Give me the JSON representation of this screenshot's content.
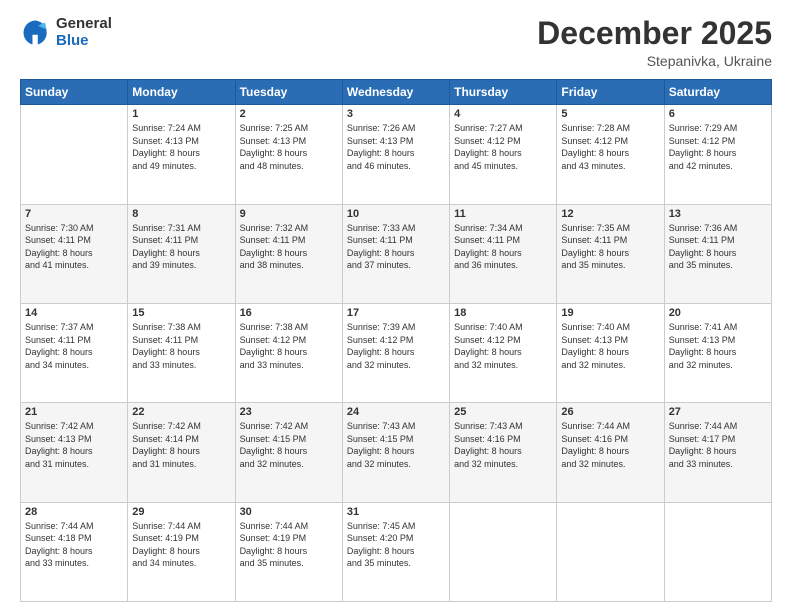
{
  "header": {
    "logo": {
      "general": "General",
      "blue": "Blue"
    },
    "title": "December 2025",
    "subtitle": "Stepanivka, Ukraine"
  },
  "calendar": {
    "days_of_week": [
      "Sunday",
      "Monday",
      "Tuesday",
      "Wednesday",
      "Thursday",
      "Friday",
      "Saturday"
    ],
    "weeks": [
      [
        {
          "day": "",
          "lines": []
        },
        {
          "day": "1",
          "lines": [
            "Sunrise: 7:24 AM",
            "Sunset: 4:13 PM",
            "Daylight: 8 hours",
            "and 49 minutes."
          ]
        },
        {
          "day": "2",
          "lines": [
            "Sunrise: 7:25 AM",
            "Sunset: 4:13 PM",
            "Daylight: 8 hours",
            "and 48 minutes."
          ]
        },
        {
          "day": "3",
          "lines": [
            "Sunrise: 7:26 AM",
            "Sunset: 4:13 PM",
            "Daylight: 8 hours",
            "and 46 minutes."
          ]
        },
        {
          "day": "4",
          "lines": [
            "Sunrise: 7:27 AM",
            "Sunset: 4:12 PM",
            "Daylight: 8 hours",
            "and 45 minutes."
          ]
        },
        {
          "day": "5",
          "lines": [
            "Sunrise: 7:28 AM",
            "Sunset: 4:12 PM",
            "Daylight: 8 hours",
            "and 43 minutes."
          ]
        },
        {
          "day": "6",
          "lines": [
            "Sunrise: 7:29 AM",
            "Sunset: 4:12 PM",
            "Daylight: 8 hours",
            "and 42 minutes."
          ]
        }
      ],
      [
        {
          "day": "7",
          "lines": [
            "Sunrise: 7:30 AM",
            "Sunset: 4:11 PM",
            "Daylight: 8 hours",
            "and 41 minutes."
          ]
        },
        {
          "day": "8",
          "lines": [
            "Sunrise: 7:31 AM",
            "Sunset: 4:11 PM",
            "Daylight: 8 hours",
            "and 39 minutes."
          ]
        },
        {
          "day": "9",
          "lines": [
            "Sunrise: 7:32 AM",
            "Sunset: 4:11 PM",
            "Daylight: 8 hours",
            "and 38 minutes."
          ]
        },
        {
          "day": "10",
          "lines": [
            "Sunrise: 7:33 AM",
            "Sunset: 4:11 PM",
            "Daylight: 8 hours",
            "and 37 minutes."
          ]
        },
        {
          "day": "11",
          "lines": [
            "Sunrise: 7:34 AM",
            "Sunset: 4:11 PM",
            "Daylight: 8 hours",
            "and 36 minutes."
          ]
        },
        {
          "day": "12",
          "lines": [
            "Sunrise: 7:35 AM",
            "Sunset: 4:11 PM",
            "Daylight: 8 hours",
            "and 35 minutes."
          ]
        },
        {
          "day": "13",
          "lines": [
            "Sunrise: 7:36 AM",
            "Sunset: 4:11 PM",
            "Daylight: 8 hours",
            "and 35 minutes."
          ]
        }
      ],
      [
        {
          "day": "14",
          "lines": [
            "Sunrise: 7:37 AM",
            "Sunset: 4:11 PM",
            "Daylight: 8 hours",
            "and 34 minutes."
          ]
        },
        {
          "day": "15",
          "lines": [
            "Sunrise: 7:38 AM",
            "Sunset: 4:11 PM",
            "Daylight: 8 hours",
            "and 33 minutes."
          ]
        },
        {
          "day": "16",
          "lines": [
            "Sunrise: 7:38 AM",
            "Sunset: 4:12 PM",
            "Daylight: 8 hours",
            "and 33 minutes."
          ]
        },
        {
          "day": "17",
          "lines": [
            "Sunrise: 7:39 AM",
            "Sunset: 4:12 PM",
            "Daylight: 8 hours",
            "and 32 minutes."
          ]
        },
        {
          "day": "18",
          "lines": [
            "Sunrise: 7:40 AM",
            "Sunset: 4:12 PM",
            "Daylight: 8 hours",
            "and 32 minutes."
          ]
        },
        {
          "day": "19",
          "lines": [
            "Sunrise: 7:40 AM",
            "Sunset: 4:13 PM",
            "Daylight: 8 hours",
            "and 32 minutes."
          ]
        },
        {
          "day": "20",
          "lines": [
            "Sunrise: 7:41 AM",
            "Sunset: 4:13 PM",
            "Daylight: 8 hours",
            "and 32 minutes."
          ]
        }
      ],
      [
        {
          "day": "21",
          "lines": [
            "Sunrise: 7:42 AM",
            "Sunset: 4:13 PM",
            "Daylight: 8 hours",
            "and 31 minutes."
          ]
        },
        {
          "day": "22",
          "lines": [
            "Sunrise: 7:42 AM",
            "Sunset: 4:14 PM",
            "Daylight: 8 hours",
            "and 31 minutes."
          ]
        },
        {
          "day": "23",
          "lines": [
            "Sunrise: 7:42 AM",
            "Sunset: 4:15 PM",
            "Daylight: 8 hours",
            "and 32 minutes."
          ]
        },
        {
          "day": "24",
          "lines": [
            "Sunrise: 7:43 AM",
            "Sunset: 4:15 PM",
            "Daylight: 8 hours",
            "and 32 minutes."
          ]
        },
        {
          "day": "25",
          "lines": [
            "Sunrise: 7:43 AM",
            "Sunset: 4:16 PM",
            "Daylight: 8 hours",
            "and 32 minutes."
          ]
        },
        {
          "day": "26",
          "lines": [
            "Sunrise: 7:44 AM",
            "Sunset: 4:16 PM",
            "Daylight: 8 hours",
            "and 32 minutes."
          ]
        },
        {
          "day": "27",
          "lines": [
            "Sunrise: 7:44 AM",
            "Sunset: 4:17 PM",
            "Daylight: 8 hours",
            "and 33 minutes."
          ]
        }
      ],
      [
        {
          "day": "28",
          "lines": [
            "Sunrise: 7:44 AM",
            "Sunset: 4:18 PM",
            "Daylight: 8 hours",
            "and 33 minutes."
          ]
        },
        {
          "day": "29",
          "lines": [
            "Sunrise: 7:44 AM",
            "Sunset: 4:19 PM",
            "Daylight: 8 hours",
            "and 34 minutes."
          ]
        },
        {
          "day": "30",
          "lines": [
            "Sunrise: 7:44 AM",
            "Sunset: 4:19 PM",
            "Daylight: 8 hours",
            "and 35 minutes."
          ]
        },
        {
          "day": "31",
          "lines": [
            "Sunrise: 7:45 AM",
            "Sunset: 4:20 PM",
            "Daylight: 8 hours",
            "and 35 minutes."
          ]
        },
        {
          "day": "",
          "lines": []
        },
        {
          "day": "",
          "lines": []
        },
        {
          "day": "",
          "lines": []
        }
      ]
    ]
  }
}
